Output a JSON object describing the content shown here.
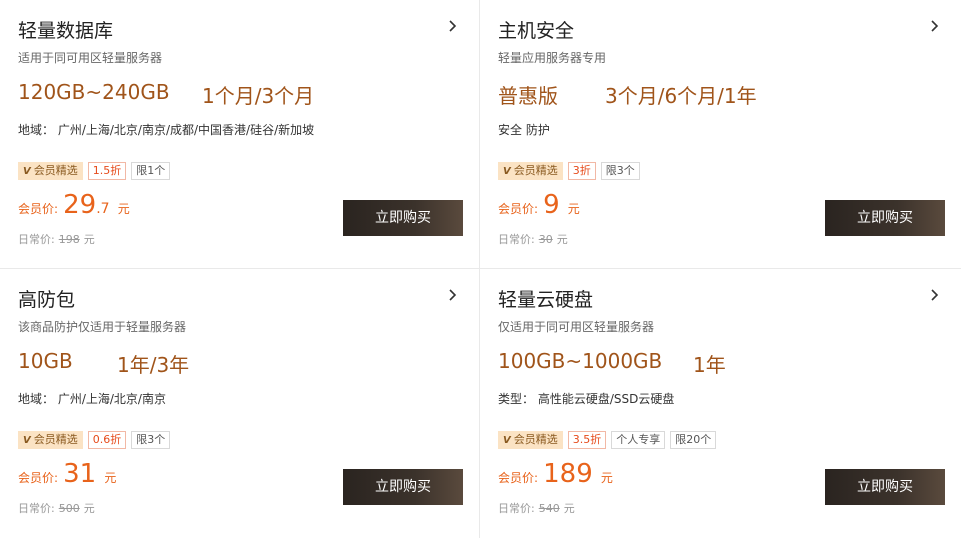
{
  "colors": {
    "accent": "#e8631b",
    "spec": "#a0541a",
    "button_bg": "#2e2823"
  },
  "cards": [
    {
      "title": "轻量数据库",
      "desc": "适用于同可用区轻量服务器",
      "spec1": "120GB~240GB",
      "spec2": "1个月/3个月",
      "meta": "地域： 广州/上海/北京/南京/成都/中国香港/硅谷/新加坡",
      "tags": [
        "会员精选",
        "1.5折",
        "限1个"
      ],
      "price_label": "会员价:",
      "price_int": "29",
      "price_dec": ".7",
      "price_unit": "元",
      "orig_label": "日常价:",
      "orig_value": "198",
      "orig_unit": "元",
      "buy": "立即购买"
    },
    {
      "title": "主机安全",
      "desc": "轻量应用服务器专用",
      "spec1": "普惠版",
      "spec2": "3个月/6个月/1年",
      "meta": "安全 防护",
      "tags": [
        "会员精选",
        "3折",
        "限3个"
      ],
      "price_label": "会员价:",
      "price_int": "9",
      "price_dec": "",
      "price_unit": "元",
      "orig_label": "日常价:",
      "orig_value": "30",
      "orig_unit": "元",
      "buy": "立即购买"
    },
    {
      "title": "高防包",
      "desc": "该商品防护仅适用于轻量服务器",
      "spec1": "10GB",
      "spec2": "1年/3年",
      "meta": "地域： 广州/上海/北京/南京",
      "tags": [
        "会员精选",
        "0.6折",
        "限3个"
      ],
      "price_label": "会员价:",
      "price_int": "31",
      "price_dec": "",
      "price_unit": "元",
      "orig_label": "日常价:",
      "orig_value": "500",
      "orig_unit": "元",
      "buy": "立即购买"
    },
    {
      "title": "轻量云硬盘",
      "desc": "仅适用于同可用区轻量服务器",
      "spec1": "100GB~1000GB",
      "spec2": "1年",
      "meta": "类型： 高性能云硬盘/SSD云硬盘",
      "tags": [
        "会员精选",
        "3.5折",
        "个人专享",
        "限20个"
      ],
      "price_label": "会员价:",
      "price_int": "189",
      "price_dec": "",
      "price_unit": "元",
      "orig_label": "日常价:",
      "orig_value": "540",
      "orig_unit": "元",
      "buy": "立即购买"
    }
  ]
}
